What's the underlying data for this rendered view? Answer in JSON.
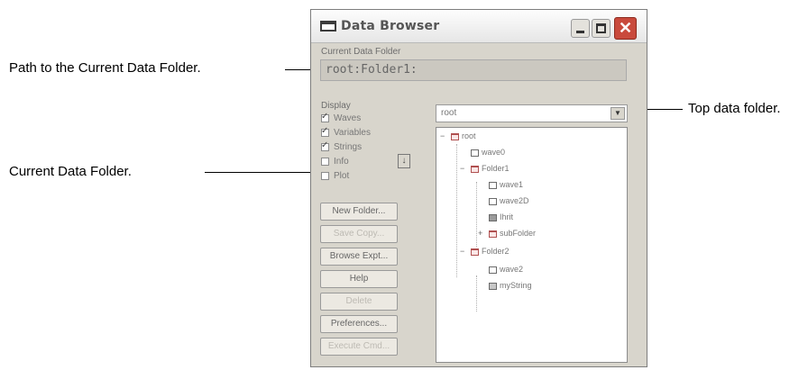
{
  "callouts": {
    "path": "Path to the Current Data Folder.",
    "current": "Current Data Folder.",
    "top": "Top data folder."
  },
  "window": {
    "title": "Data Browser",
    "current_folder_label": "Current Data Folder",
    "current_folder_path": "root:Folder1:",
    "display_label": "Display",
    "display_options": [
      {
        "label": "Waves",
        "checked": true
      },
      {
        "label": "Variables",
        "checked": true
      },
      {
        "label": "Strings",
        "checked": true
      },
      {
        "label": "Info",
        "checked": false
      },
      {
        "label": "Plot",
        "checked": false
      }
    ],
    "buttons": [
      {
        "label": "New Folder...",
        "enabled": true
      },
      {
        "label": "Save Copy...",
        "enabled": false
      },
      {
        "label": "Browse Expt...",
        "enabled": true
      },
      {
        "label": "Help",
        "enabled": true
      },
      {
        "label": "Delete",
        "enabled": false
      },
      {
        "label": "Preferences...",
        "enabled": true
      },
      {
        "label": "Execute Cmd...",
        "enabled": false
      }
    ],
    "top_folder_select": "root",
    "tree": [
      {
        "label": "root",
        "type": "folder"
      },
      {
        "label": "wave0",
        "type": "wave"
      },
      {
        "label": "Folder1",
        "type": "folder"
      },
      {
        "label": "wave1",
        "type": "wave"
      },
      {
        "label": "wave2D",
        "type": "wave"
      },
      {
        "label": "Ihrit",
        "type": "var"
      },
      {
        "label": "subFolder",
        "type": "folder"
      },
      {
        "label": "Folder2",
        "type": "folder"
      },
      {
        "label": "wave2",
        "type": "wave"
      },
      {
        "label": "myString",
        "type": "str"
      }
    ]
  },
  "colors": {
    "marker": "#c81a1a",
    "window_bg": "#d8d5cc",
    "close": "#c94a3c"
  }
}
